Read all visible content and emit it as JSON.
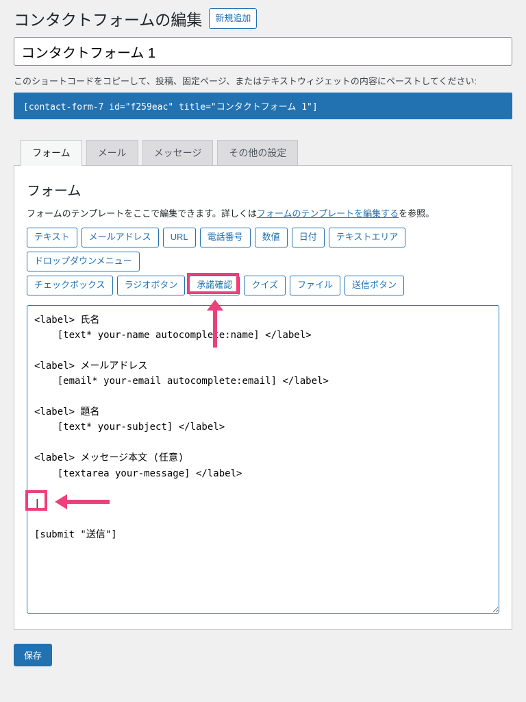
{
  "header": {
    "page_title": "コンタクトフォームの編集",
    "add_new_label": "新規追加"
  },
  "form_title_value": "コンタクトフォーム 1",
  "shortcode_help": "このショートコードをコピーして、投稿、固定ページ、またはテキストウィジェットの内容にペーストしてください:",
  "shortcode": "[contact-form-7 id=\"f259eac\" title=\"コンタクトフォーム 1\"]",
  "tabs": [
    {
      "label": "フォーム"
    },
    {
      "label": "メール"
    },
    {
      "label": "メッセージ"
    },
    {
      "label": "その他の設定"
    }
  ],
  "panel": {
    "heading": "フォーム",
    "desc_prefix": "フォームのテンプレートをここで編集できます。詳しくは",
    "desc_link": "フォームのテンプレートを編集する",
    "desc_suffix": "を参照。"
  },
  "tag_buttons_row1": [
    "テキスト",
    "メールアドレス",
    "URL",
    "電話番号",
    "数値",
    "日付",
    "テキストエリア",
    "ドロップダウンメニュー"
  ],
  "tag_buttons_row2": [
    "チェックボックス",
    "ラジオボタン",
    "承諾確認",
    "クイズ",
    "ファイル",
    "送信ボタン"
  ],
  "form_template": "<label> 氏名\n    [text* your-name autocomplete:name] </label>\n\n<label> メールアドレス\n    [email* your-email autocomplete:email] </label>\n\n<label> 題名\n    [text* your-subject] </label>\n\n<label> メッセージ本文 (任意)\n    [textarea your-message] </label>\n\n|\n\n[submit \"送信\"]",
  "save_label": "保存"
}
